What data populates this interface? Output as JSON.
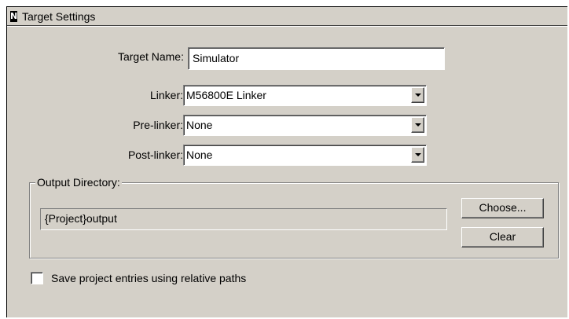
{
  "panel": {
    "title": "Target Settings",
    "title_icon": "panel-glyph-icon"
  },
  "target_name": {
    "label": "Target Name:",
    "value": "Simulator"
  },
  "linker": {
    "label": "Linker:",
    "value": "M56800E Linker"
  },
  "pre_linker": {
    "label": "Pre-linker:",
    "value": "None"
  },
  "post_linker": {
    "label": "Post-linker:",
    "value": "None"
  },
  "output_directory": {
    "legend": "Output Directory:",
    "path": "{Project}output",
    "choose_label": "Choose...",
    "clear_label": "Clear"
  },
  "relative_paths": {
    "label": "Save project entries using relative paths",
    "checked": false
  },
  "colors": {
    "panel_bg": "#d4d0c8",
    "field_bg": "#ffffff"
  }
}
